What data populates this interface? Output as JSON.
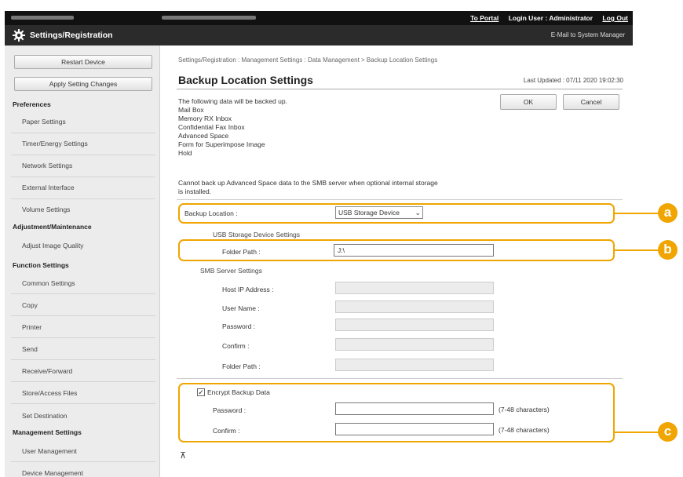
{
  "topbar": {
    "to_portal": "To Portal",
    "login_user": "Login User : Administrator",
    "logout": "Log Out"
  },
  "titlebar": {
    "title": "Settings/Registration",
    "email": "E-Mail to System Manager",
    "icon": "gear-icon"
  },
  "sidebar": {
    "restart": "Restart Device",
    "apply": "Apply Setting Changes",
    "groups": {
      "preferences": "Preferences",
      "adjustment": "Adjustment/Maintenance",
      "function": "Function Settings",
      "management": "Management Settings"
    },
    "items": {
      "paper": "Paper Settings",
      "timer": "Timer/Energy Settings",
      "network": "Network Settings",
      "external": "External Interface",
      "volume": "Volume Settings",
      "adjust_quality": "Adjust Image Quality",
      "common": "Common Settings",
      "copy": "Copy",
      "printer": "Printer",
      "send": "Send",
      "receive": "Receive/Forward",
      "store": "Store/Access Files",
      "destination": "Set Destination",
      "user_mgmt": "User Management",
      "device_mgmt": "Device Management"
    }
  },
  "main": {
    "breadcrumb": "Settings/Registration : Management Settings : Data Management > Backup Location Settings",
    "title": "Backup Location Settings",
    "last_updated": "Last Updated : 07/11 2020 19:02:30",
    "ok": "OK",
    "cancel": "Cancel",
    "intro": "The following data will be backed up.",
    "data_list": [
      "Mail Box",
      "Memory RX Inbox",
      "Confidential Fax Inbox",
      "Advanced Space",
      "Form for Superimpose Image",
      "Hold"
    ],
    "note_line1": "Cannot back up Advanced Space data to the SMB server when optional internal storage",
    "note_line2": "is installed.",
    "backup_location_label": "Backup Location :",
    "backup_location_value": "USB Storage Device",
    "usb_heading": "USB Storage Device Settings",
    "folder_path_label": "Folder Path :",
    "folder_path_value": "J:\\",
    "smb_heading": "SMB Server Settings",
    "host_label": "Host IP Address :",
    "user_label": "User Name :",
    "password_label": "Password :",
    "confirm_label": "Confirm :",
    "smb_folder_label": "Folder Path :",
    "encrypt_label": "Encrypt Backup Data",
    "encrypt_checked": true,
    "enc_password_label": "Password :",
    "enc_confirm_label": "Confirm :",
    "enc_hint1": "(7-48 characters)",
    "enc_hint2": "(7-48 characters)"
  },
  "callouts": {
    "a": "a",
    "b": "b",
    "c": "c"
  },
  "colors": {
    "highlight": "#f0a500",
    "titlebar": "#2b2b2b"
  }
}
